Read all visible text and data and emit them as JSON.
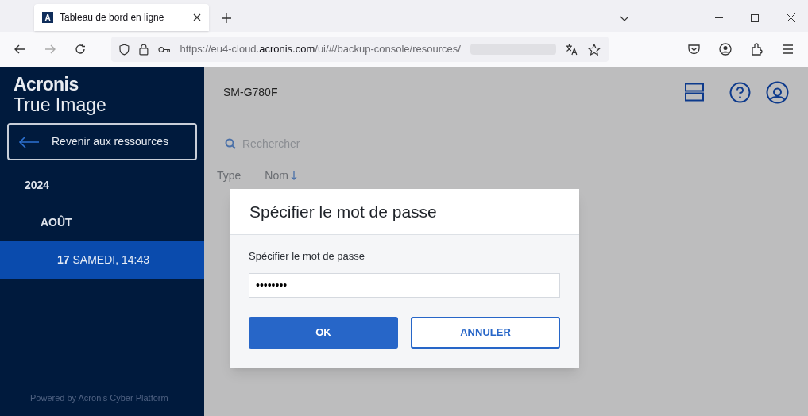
{
  "browser": {
    "tab": {
      "title": "Tableau de bord en ligne",
      "favicon": "A"
    },
    "url": {
      "prefix": "https://eu4-cloud.",
      "domain": "acronis.com",
      "path": "/ui/#/backup-console/resources/"
    }
  },
  "sidebar": {
    "brand": "Acronis",
    "product": "True Image",
    "back_button": "Revenir aux ressources",
    "tree": [
      {
        "label": "2024",
        "selected": false,
        "children": [
          {
            "label": "AOÛT",
            "selected": false,
            "children": [
              {
                "label": "**17** SAMEDI, 14:43",
                "selected": true
              }
            ]
          }
        ]
      }
    ],
    "footer": "Powered by Acronis Cyber Platform"
  },
  "main": {
    "title": "SM-G780F",
    "search": {
      "placeholder": "Rechercher"
    },
    "columns": [
      "Type",
      "Nom"
    ]
  },
  "dialog": {
    "title": "Spécifier le mot de passe",
    "field_label": "Spécifier le mot de passe",
    "password": "••••••••",
    "buttons": [
      {
        "label": "OK",
        "kind": "primary"
      },
      {
        "label": "ANNULER",
        "kind": "secondary"
      }
    ]
  }
}
